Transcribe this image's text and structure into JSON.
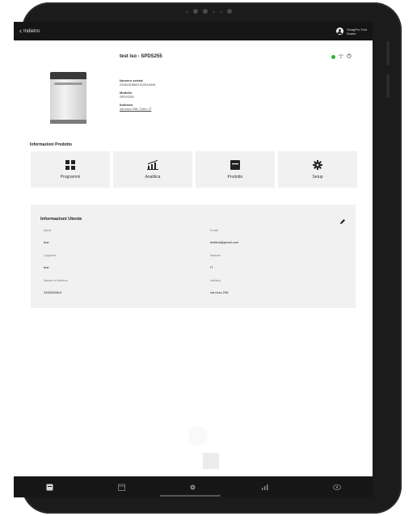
{
  "topbar": {
    "back_label": "Indietro",
    "user_line1": "SmagPro Test",
    "user_line2": "Dealer"
  },
  "product": {
    "title": "test iso - SPDS255",
    "status_color": "#34b233",
    "fields": [
      {
        "label": "Numero seriale",
        "value": "23451305631313344444"
      },
      {
        "label": "Modello",
        "value": "SPDS255"
      },
      {
        "label": "Indirizzo",
        "value": "via rizzo 298, Turin, IT"
      }
    ]
  },
  "section_title": "Informazioni Prodotto",
  "tiles": [
    {
      "label": "Programmi",
      "icon": "grid-icon"
    },
    {
      "label": "Analitica",
      "icon": "analytics-icon"
    },
    {
      "label": "Prodotto",
      "icon": "product-icon"
    },
    {
      "label": "Setup",
      "icon": "gear-icon"
    }
  ],
  "user_info": {
    "title": "Informazioni Utente",
    "left": [
      {
        "label": "Nome",
        "value": "test"
      },
      {
        "label": "Cognome",
        "value": "test"
      },
      {
        "label": "Numero di telefono",
        "value": "3333425614"
      }
    ],
    "right": [
      {
        "label": "E-mail",
        "value": "testtest@pmail.com"
      },
      {
        "label": "Nazione",
        "value": "IT"
      },
      {
        "label": "Indirizzo",
        "value": "via rizzo 298"
      }
    ]
  },
  "bottom_nav": [
    "home-icon",
    "calendar-icon",
    "settings-icon",
    "chart-icon",
    "eye-icon"
  ]
}
